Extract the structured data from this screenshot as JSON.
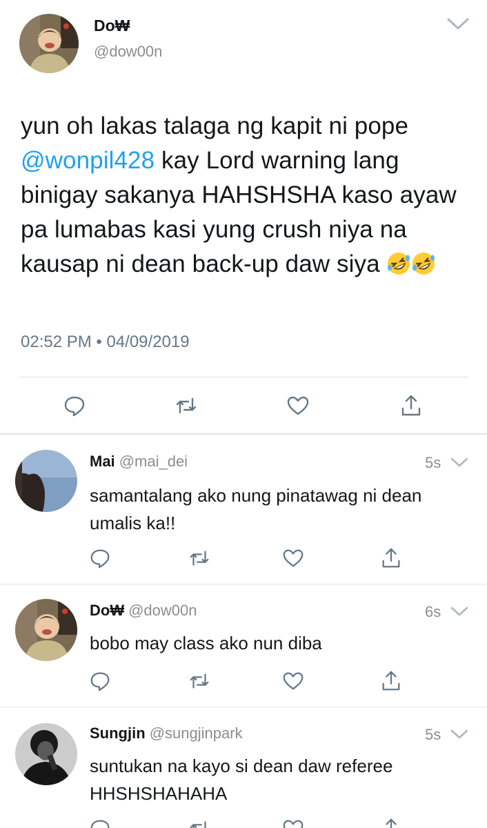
{
  "main_tweet": {
    "name": "Do₩",
    "handle": "@dow00n",
    "text_before": "yun oh lakas talaga ng kapit ni pope ",
    "mention": "@wonpil428",
    "text_after": " kay Lord warning lang binigay sakanya HAHSHSHA kaso ayaw pa lumabas kasi yung crush niya na kausap ni dean back-up daw siya ",
    "emojis": [
      "rofl-emoji",
      "rofl-emoji"
    ],
    "timestamp": "02:52 PM • 04/09/2019",
    "actions": [
      "reply-icon",
      "retweet-icon",
      "like-icon",
      "share-icon"
    ]
  },
  "replies": [
    {
      "name": "Mai",
      "handle": "@mai_dei",
      "time": "5s",
      "text": "samantalang ako nung pinatawag ni dean umalis ka!!"
    },
    {
      "name": "Do₩",
      "handle": "@dow00n",
      "time": "6s",
      "text": "bobo may class ako nun diba"
    },
    {
      "name": "Sungjin",
      "handle": "@sungjinpark",
      "time": "5s",
      "text": "suntukan na kayo si dean daw referee HHSHSHAHAHA"
    }
  ],
  "colors": {
    "mention": "#1da1f2",
    "text": "#14171a",
    "secondary": "#8a8d91",
    "icon": "#657786"
  }
}
